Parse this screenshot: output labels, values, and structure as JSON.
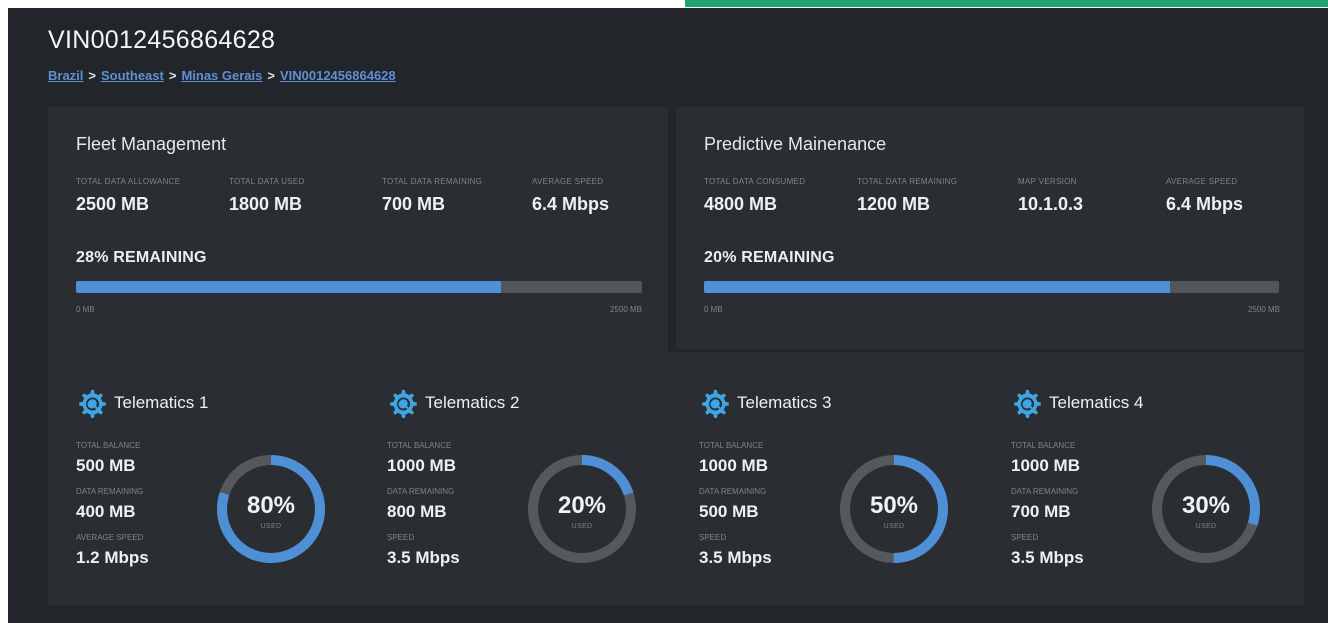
{
  "vehicle": {
    "vin": "VIN0012456864628"
  },
  "breadcrumb": [
    "Brazil",
    "Southeast",
    "Minas Gerais",
    "VIN0012456864628"
  ],
  "colors": {
    "accent": "#1fa56f",
    "bar_fill": "#4f8fd6",
    "track": "#52565b",
    "gear": "#3fa4e4"
  },
  "fleet": {
    "title": "Fleet Management",
    "stats": [
      {
        "label": "TOTAL DATA ALLOWANCE",
        "value": "2500 MB"
      },
      {
        "label": "TOTAL DATA USED",
        "value": "1800 MB"
      },
      {
        "label": "TOTAL DATA REMAINING",
        "value": "700 MB"
      },
      {
        "label": "AVERAGE SPEED",
        "value": "6.4 Mbps"
      }
    ],
    "remaining_label": "28% REMAINING",
    "bar_fill_fraction": 0.75,
    "bar_min": "0 MB",
    "bar_max": "2500 MB"
  },
  "predictive": {
    "title": "Predictive Mainenance",
    "stats": [
      {
        "label": "TOTAL DATA CONSUMED",
        "value": "4800 MB"
      },
      {
        "label": "TOTAL DATA REMAINING",
        "value": "1200 MB"
      },
      {
        "label": "MAP VERSION",
        "value": "10.1.0.3"
      },
      {
        "label": "AVERAGE SPEED",
        "value": "6.4 Mbps"
      }
    ],
    "remaining_label": "20% REMAINING",
    "bar_fill_fraction": 0.81,
    "bar_min": "0 MB",
    "bar_max": "2500 MB"
  },
  "telematics": [
    {
      "name": "Telematics 1",
      "balance_label": "TOTAL BALANCE",
      "balance": "500 MB",
      "remaining_label": "DATA REMAINING",
      "remaining": "400 MB",
      "speed_label": "AVERAGE SPEED",
      "speed": "1.2 Mbps",
      "used_pct": 80,
      "pct_text": "80%",
      "used_text": "USED"
    },
    {
      "name": "Telematics 2",
      "balance_label": "TOTAL BALANCE",
      "balance": "1000 MB",
      "remaining_label": "DATA REMAINING",
      "remaining": "800 MB",
      "speed_label": "SPEED",
      "speed": "3.5 Mbps",
      "used_pct": 20,
      "pct_text": "20%",
      "used_text": "USED"
    },
    {
      "name": "Telematics 3",
      "balance_label": "TOTAL BALANCE",
      "balance": "1000 MB",
      "remaining_label": "DATA REMAINING",
      "remaining": "500 MB",
      "speed_label": "SPEED",
      "speed": "3.5 Mbps",
      "used_pct": 50,
      "pct_text": "50%",
      "used_text": "USED"
    },
    {
      "name": "Telematics 4",
      "balance_label": "TOTAL BALANCE",
      "balance": "1000 MB",
      "remaining_label": "DATA REMAINING",
      "remaining": "700 MB",
      "speed_label": "SPEED",
      "speed": "3.5 Mbps",
      "used_pct": 30,
      "pct_text": "30%",
      "used_text": "USED"
    }
  ]
}
